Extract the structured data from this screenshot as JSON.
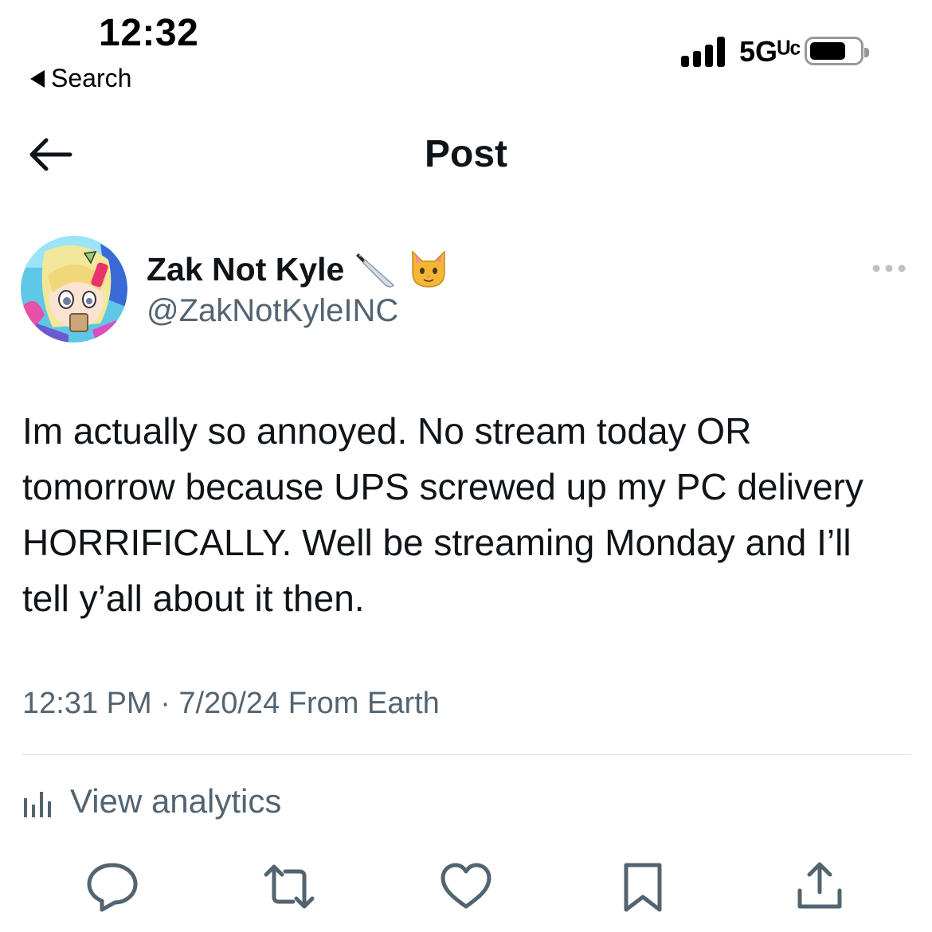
{
  "status_bar": {
    "time": "12:32",
    "back_label": "Search",
    "network": "5Gᵁᶜ"
  },
  "header": {
    "title": "Post"
  },
  "author": {
    "display_name": "Zak Not Kyle",
    "emoji_1": "knife-icon",
    "emoji_2": "cat-face-icon",
    "handle": "@ZakNotKyleINC"
  },
  "tweet": {
    "text": "Im actually so annoyed. No stream today OR tomorrow because UPS screwed up my PC delivery HORRIFICALLY. Well be streaming Monday and I’ll tell y’all about it then.",
    "meta": "12:31 PM · 7/20/24 From Earth"
  },
  "analytics": {
    "label": "View analytics"
  },
  "actions": [
    "reply-icon",
    "repost-icon",
    "like-icon",
    "bookmark-icon",
    "share-icon"
  ],
  "colors": {
    "text": "#0f1419",
    "secondary": "#536471",
    "divider": "#dadfe3"
  }
}
